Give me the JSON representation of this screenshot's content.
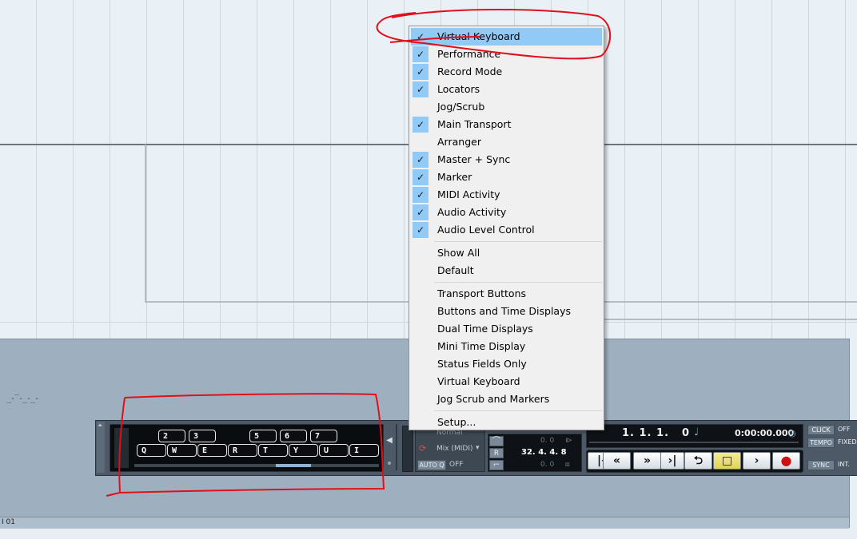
{
  "colors": {
    "menu_highlight": "#91c9f7",
    "annotation_red": "#e0101a",
    "transport_bg": "#4d5966",
    "active_button": "#f6ee8e"
  },
  "project": {
    "midi_mini_text": "_-‾-_-_-",
    "status_text": "I 01"
  },
  "context_menu": {
    "checked_items": [
      {
        "label": "Virtual Keyboard",
        "checked": true,
        "hovered": true
      },
      {
        "label": "Performance",
        "checked": true
      },
      {
        "label": "Record Mode",
        "checked": true
      },
      {
        "label": "Locators",
        "checked": true
      },
      {
        "label": "Jog/Scrub",
        "checked": false
      },
      {
        "label": "Main Transport",
        "checked": true
      },
      {
        "label": "Arranger",
        "checked": false
      },
      {
        "label": "Master + Sync",
        "checked": true
      },
      {
        "label": "Marker",
        "checked": true
      },
      {
        "label": "MIDI Activity",
        "checked": true
      },
      {
        "label": "Audio Activity",
        "checked": true
      },
      {
        "label": "Audio Level Control",
        "checked": true
      }
    ],
    "view_items": [
      "Show All",
      "Default"
    ],
    "preset_items": [
      "Transport Buttons",
      "Buttons and Time Displays",
      "Dual Time Displays",
      "Mini Time Display",
      "Status Fields Only",
      "Virtual Keyboard",
      "Jog Scrub and Markers"
    ],
    "setup_item": "Setup..."
  },
  "virtual_keyboard": {
    "black_keys": [
      "2",
      "3",
      "5",
      "6",
      "7"
    ],
    "white_keys": [
      "Q",
      "W",
      "E",
      "R",
      "T",
      "Y",
      "U",
      "I"
    ]
  },
  "record_mode": {
    "normal_label": "Normal",
    "mix_label": "Mix (MIDI)",
    "auto_q_label": "AUTO Q",
    "auto_q_value": "OFF"
  },
  "locators": {
    "left_value": "0. 0",
    "right_value": "0. 0",
    "punch_label": "R",
    "position": "32. 4. 4. 8"
  },
  "main_transport": {
    "bars": "1. 1. 1.",
    "ticks": "0",
    "time": "0:00:00.000",
    "note_icon": "♩",
    "clock_icon": "clock-icon",
    "buttons": [
      {
        "name": "go-to-start",
        "symbol": "⏮"
      },
      {
        "name": "rewind",
        "symbol": "«"
      },
      {
        "name": "fast-forward",
        "symbol": "»"
      },
      {
        "name": "go-to-end",
        "symbol": "⏭"
      },
      {
        "name": "cycle",
        "symbol": "⮌"
      },
      {
        "name": "stop",
        "symbol": "■"
      },
      {
        "name": "play",
        "symbol": "›"
      },
      {
        "name": "record",
        "symbol": "●"
      }
    ]
  },
  "master_sync": {
    "click_label": "CLICK",
    "click_value": "OFF",
    "tempo_label": "TEMPO",
    "tempo_value": "FIXED",
    "sync_label": "SYNC",
    "sync_value": "INT."
  }
}
